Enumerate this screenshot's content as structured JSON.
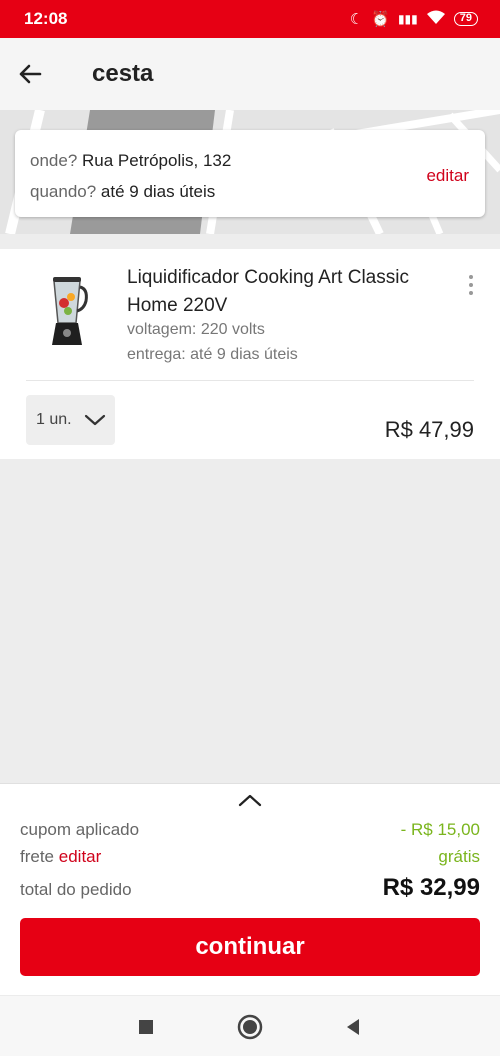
{
  "status_bar": {
    "time": "12:08",
    "battery": "79"
  },
  "header": {
    "title": "cesta"
  },
  "address": {
    "where_label": "onde?",
    "where_value": "Rua Petrópolis, 132",
    "when_label": "quando?",
    "when_value": "até 9 dias úteis",
    "edit_label": "editar"
  },
  "product": {
    "name": "Liquidificador Cooking Art Classic Home 220V",
    "voltage": "voltagem: 220 volts",
    "delivery": "entrega: até 9 dias úteis",
    "quantity": "1 un.",
    "price": "R$ 47,99"
  },
  "summary": {
    "coupon_label": "cupom aplicado",
    "coupon_value": "- R$ 15,00",
    "shipping_label": "frete",
    "shipping_edit": "editar",
    "shipping_value": "grátis",
    "total_label": "total do pedido",
    "total_value": "R$ 32,99",
    "continue_label": "continuar"
  },
  "colors": {
    "brand_red": "#e60014",
    "link_red": "#d0021b",
    "green": "#7ab51d"
  },
  "icons": [
    "back-arrow-icon",
    "kebab-menu-icon",
    "chevron-down-icon",
    "chevron-up-icon",
    "nav-recent-icon",
    "nav-home-icon",
    "nav-back-icon"
  ]
}
